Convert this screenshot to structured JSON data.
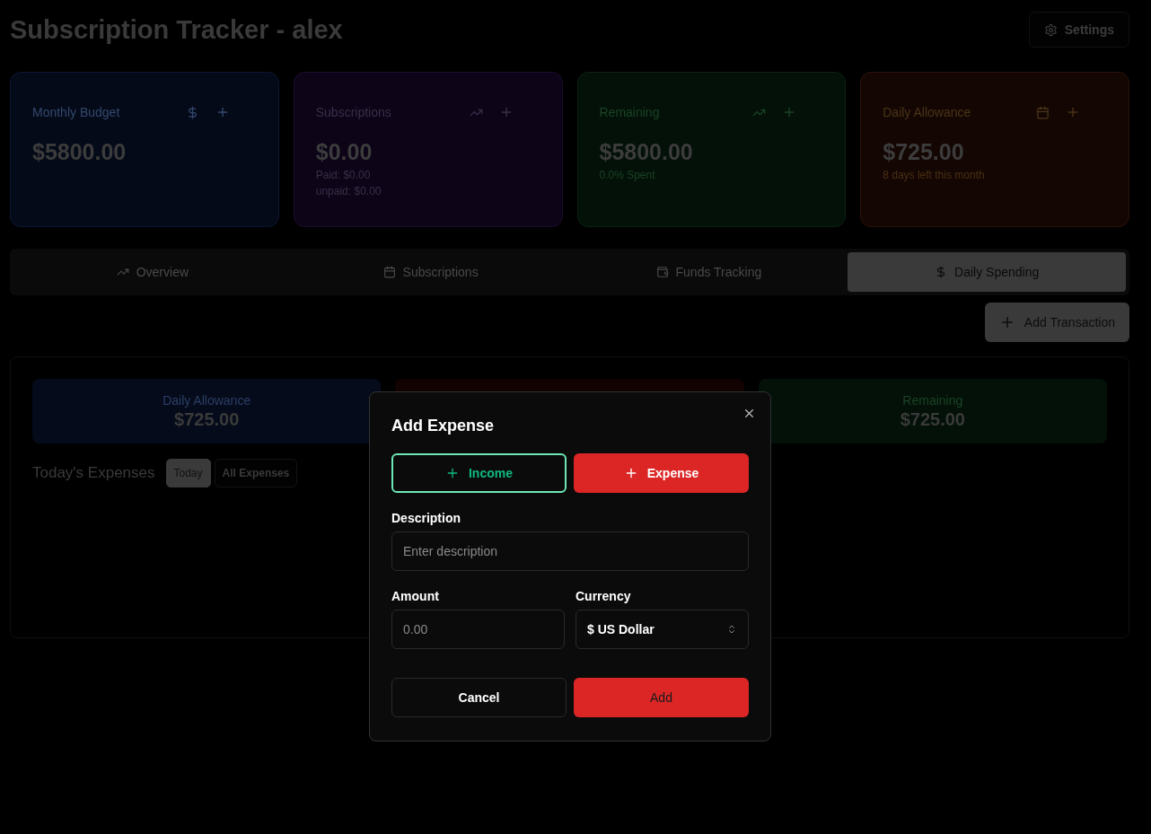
{
  "header": {
    "title": "Subscription Tracker - alex",
    "settings_button": "Settings"
  },
  "stat_cards": [
    {
      "kind": "budget",
      "label": "Monthly Budget",
      "value": "$5800.00"
    },
    {
      "kind": "subscriptions",
      "label": "Subscriptions",
      "value": "$0.00",
      "notes": [
        "Paid: $0.00",
        "unpaid: $0.00"
      ]
    },
    {
      "kind": "remaining",
      "label": "Remaining",
      "value": "$5800.00",
      "notes": [
        "0.0% Spent"
      ]
    },
    {
      "kind": "allowance",
      "label": "Daily Allowance",
      "value": "$725.00",
      "notes": [
        "8 days left this month"
      ]
    }
  ],
  "tabs": [
    {
      "kind": "overview",
      "label": "Overview",
      "selected": false
    },
    {
      "kind": "subscriptions",
      "label": "Subscriptions",
      "selected": false
    },
    {
      "kind": "funds",
      "label": "Funds Tracking",
      "selected": false
    },
    {
      "kind": "daily",
      "label": "Daily Spending",
      "selected": true
    }
  ],
  "add_transaction_button": "Add Transaction",
  "summary_boxes": [
    {
      "kind": "daily",
      "label": "Daily Allowance",
      "value": "$725.00"
    },
    {
      "kind": "spent"
    },
    {
      "kind": "remaining",
      "label": "Remaining",
      "value": "$725.00"
    }
  ],
  "expenses": {
    "title": "Today's Expenses",
    "filters": [
      {
        "label": "Today",
        "selected": true
      },
      {
        "label": "All Expenses",
        "selected": false
      }
    ]
  },
  "dialog": {
    "title": "Add Expense",
    "types": [
      {
        "kind": "income",
        "label": "Income",
        "selected": false
      },
      {
        "kind": "expense",
        "label": "Expense",
        "selected": true
      }
    ],
    "description": {
      "label": "Description",
      "placeholder": "Enter description"
    },
    "amount": {
      "label": "Amount",
      "placeholder": "0.00"
    },
    "currency": {
      "label": "Currency",
      "value": "$ US Dollar"
    },
    "cancel_button": "Cancel",
    "add_button": "Add"
  }
}
